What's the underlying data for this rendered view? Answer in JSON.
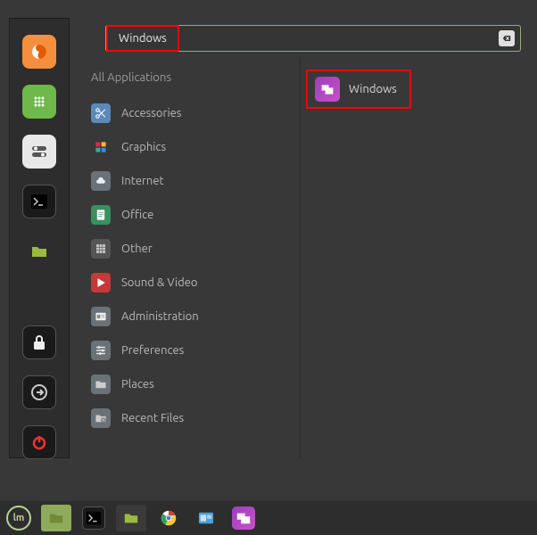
{
  "search": {
    "value": "Windows",
    "clear_glyph": "⌫"
  },
  "categories": {
    "header": "All Applications",
    "items": [
      {
        "name": "accessories",
        "label": "Accessories",
        "icon": "scissors",
        "bg": "#5a8bb8"
      },
      {
        "name": "graphics",
        "label": "Graphics",
        "icon": "palette",
        "bg": "grad-rainbow"
      },
      {
        "name": "internet",
        "label": "Internet",
        "icon": "cloud",
        "bg": "#6a7278"
      },
      {
        "name": "office",
        "label": "Office",
        "icon": "document",
        "bg": "#3a9060"
      },
      {
        "name": "other",
        "label": "Other",
        "icon": "grid",
        "bg": "#555555"
      },
      {
        "name": "sound-video",
        "label": "Sound & Video",
        "icon": "play",
        "bg": "#c73838"
      },
      {
        "name": "administration",
        "label": "Administration",
        "icon": "id-card",
        "bg": "#6a7278"
      },
      {
        "name": "preferences",
        "label": "Preferences",
        "icon": "sliders",
        "bg": "#6a7278"
      },
      {
        "name": "places",
        "label": "Places",
        "icon": "folder",
        "bg": "#6a7278"
      },
      {
        "name": "recent-files",
        "label": "Recent Files",
        "icon": "folder-clock",
        "bg": "#6a7278"
      }
    ]
  },
  "results": [
    {
      "name": "windows-app",
      "label": "Windows",
      "icon": "windows"
    }
  ],
  "sidebar": [
    {
      "name": "firefox",
      "icon": "firefox",
      "bg": "#f68f3c"
    },
    {
      "name": "software-manager",
      "icon": "grid-circle",
      "bg": "#6fb84a"
    },
    {
      "name": "system-settings",
      "icon": "toggles",
      "bg": "#e8e8e8"
    },
    {
      "name": "terminal",
      "icon": "terminal",
      "bg": "#1a1a1a"
    },
    {
      "name": "files",
      "icon": "folder-open",
      "bg": "#9abb40"
    },
    {
      "name": "lock",
      "icon": "lock",
      "bg": "#1a1a1a"
    },
    {
      "name": "logout",
      "icon": "logout-arrow",
      "bg": "#1a1a1a"
    },
    {
      "name": "power",
      "icon": "power",
      "bg": "#1a1a1a"
    }
  ],
  "taskbar": [
    {
      "name": "mint-menu",
      "icon": "mint"
    },
    {
      "name": "files",
      "icon": "folder-open",
      "bg": "#9abb40",
      "active": true
    },
    {
      "name": "terminal",
      "icon": "terminal",
      "bg": "#1a1a1a"
    },
    {
      "name": "files-2",
      "icon": "folder-open",
      "bg": "#9abb40",
      "alt": true
    },
    {
      "name": "chrome",
      "icon": "chrome"
    },
    {
      "name": "updates",
      "icon": "workspace"
    },
    {
      "name": "windows-app",
      "icon": "windows",
      "bg": "#9b3fbf"
    }
  ]
}
